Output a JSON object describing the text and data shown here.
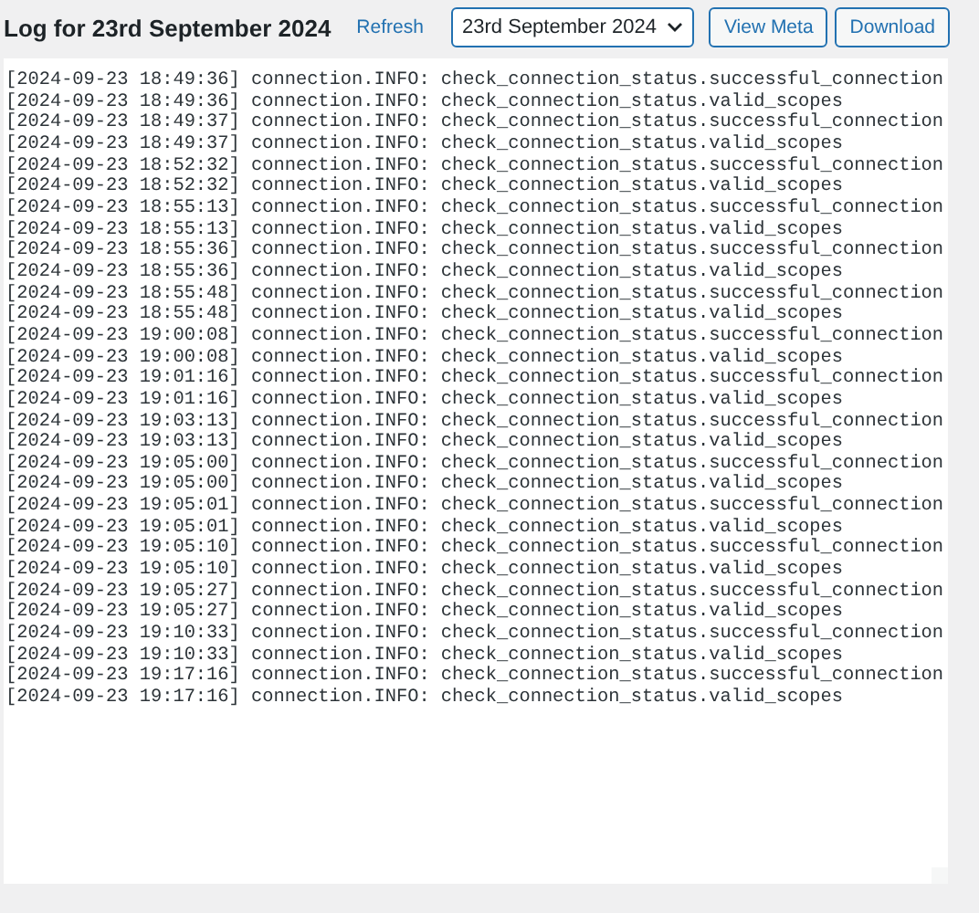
{
  "header": {
    "title": "Log for 23rd September 2024",
    "refresh_link": "Refresh",
    "date_select": {
      "value": "23rd September 2024"
    },
    "buttons": [
      "View Meta",
      "Download"
    ]
  },
  "log": {
    "lines": [
      "[2024-09-23 18:49:36] connection.INFO: check_connection_status.successful_connection",
      "[2024-09-23 18:49:36] connection.INFO: check_connection_status.valid_scopes",
      "[2024-09-23 18:49:37] connection.INFO: check_connection_status.successful_connection",
      "[2024-09-23 18:49:37] connection.INFO: check_connection_status.valid_scopes",
      "[2024-09-23 18:52:32] connection.INFO: check_connection_status.successful_connection",
      "[2024-09-23 18:52:32] connection.INFO: check_connection_status.valid_scopes",
      "[2024-09-23 18:55:13] connection.INFO: check_connection_status.successful_connection",
      "[2024-09-23 18:55:13] connection.INFO: check_connection_status.valid_scopes",
      "[2024-09-23 18:55:36] connection.INFO: check_connection_status.successful_connection",
      "[2024-09-23 18:55:36] connection.INFO: check_connection_status.valid_scopes",
      "[2024-09-23 18:55:48] connection.INFO: check_connection_status.successful_connection",
      "[2024-09-23 18:55:48] connection.INFO: check_connection_status.valid_scopes",
      "[2024-09-23 19:00:08] connection.INFO: check_connection_status.successful_connection",
      "[2024-09-23 19:00:08] connection.INFO: check_connection_status.valid_scopes",
      "[2024-09-23 19:01:16] connection.INFO: check_connection_status.successful_connection",
      "[2024-09-23 19:01:16] connection.INFO: check_connection_status.valid_scopes",
      "[2024-09-23 19:03:13] connection.INFO: check_connection_status.successful_connection",
      "[2024-09-23 19:03:13] connection.INFO: check_connection_status.valid_scopes",
      "[2024-09-23 19:05:00] connection.INFO: check_connection_status.successful_connection",
      "[2024-09-23 19:05:00] connection.INFO: check_connection_status.valid_scopes",
      "[2024-09-23 19:05:01] connection.INFO: check_connection_status.successful_connection",
      "[2024-09-23 19:05:01] connection.INFO: check_connection_status.valid_scopes",
      "[2024-09-23 19:05:10] connection.INFO: check_connection_status.successful_connection",
      "[2024-09-23 19:05:10] connection.INFO: check_connection_status.valid_scopes",
      "[2024-09-23 19:05:27] connection.INFO: check_connection_status.successful_connection",
      "[2024-09-23 19:05:27] connection.INFO: check_connection_status.valid_scopes",
      "[2024-09-23 19:10:33] connection.INFO: check_connection_status.successful_connection",
      "[2024-09-23 19:10:33] connection.INFO: check_connection_status.valid_scopes",
      "[2024-09-23 19:17:16] connection.INFO: check_connection_status.successful_connection",
      "[2024-09-23 19:17:16] connection.INFO: check_connection_status.valid_scopes"
    ]
  }
}
